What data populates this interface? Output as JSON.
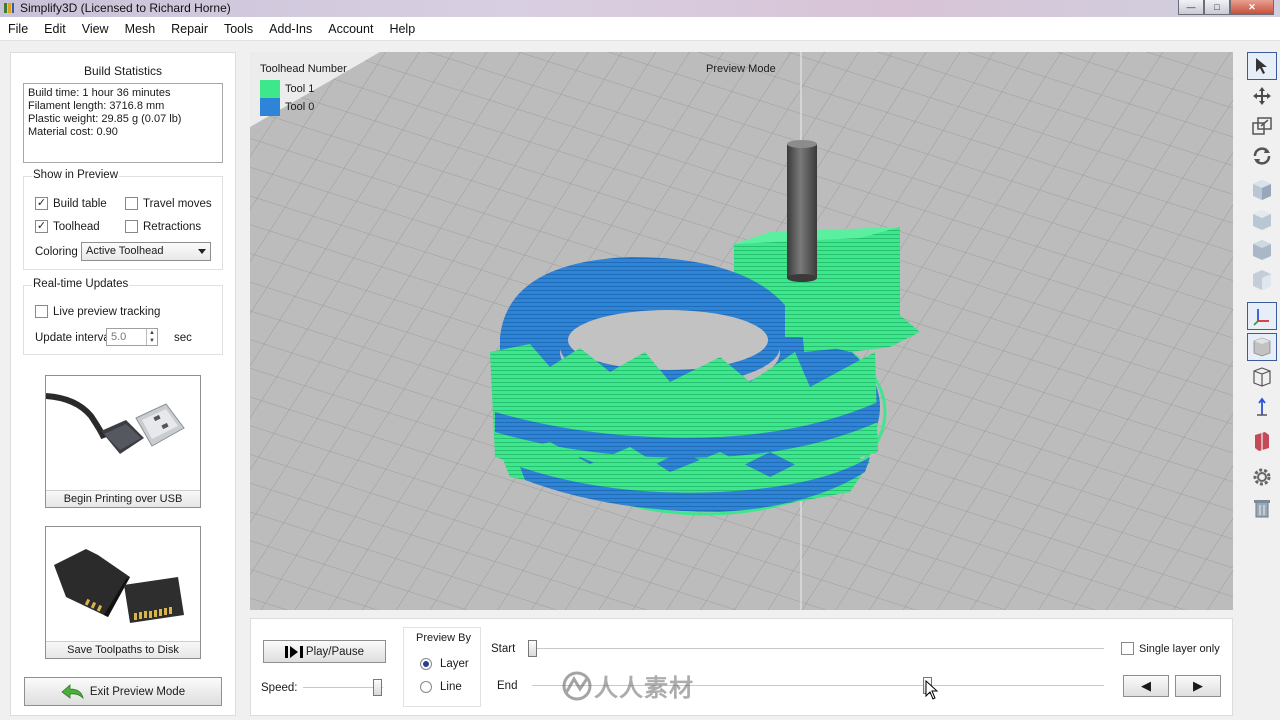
{
  "window": {
    "title": "Simplify3D (Licensed to Richard Horne)",
    "minimize_glyph": "—",
    "maximize_glyph": "□",
    "close_glyph": "✕"
  },
  "menu": [
    "File",
    "Edit",
    "View",
    "Mesh",
    "Repair",
    "Tools",
    "Add-Ins",
    "Account",
    "Help"
  ],
  "left_panel": {
    "build_statistics": {
      "title": "Build Statistics",
      "lines": [
        "Build time: 1 hour 36 minutes",
        "Filament length: 3716.8 mm",
        "Plastic weight: 29.85 g (0.07 lb)",
        "Material cost: 0.90"
      ]
    },
    "show_in_preview": {
      "title": "Show in Preview",
      "build_table": {
        "label": "Build table",
        "checked": true
      },
      "travel_moves": {
        "label": "Travel moves",
        "checked": false
      },
      "toolhead": {
        "label": "Toolhead",
        "checked": true
      },
      "retractions": {
        "label": "Retractions",
        "checked": false
      },
      "coloring_label": "Coloring",
      "coloring_value": "Active Toolhead"
    },
    "realtime_updates": {
      "title": "Real-time Updates",
      "live_preview": {
        "label": "Live preview tracking",
        "checked": false
      },
      "update_interval_label": "Update interval",
      "update_interval_value": "5.0",
      "unit": "sec"
    },
    "usb_button_label": "Begin Printing over USB",
    "sd_button_label": "Save Toolpaths to Disk",
    "exit_button_label": "Exit Preview Mode"
  },
  "viewport": {
    "legend_title": "Toolhead Number",
    "legend": [
      {
        "label": "Tool 1",
        "color": "#3ee68c"
      },
      {
        "label": "Tool 0",
        "color": "#2e84d6"
      }
    ],
    "mode_label": "Preview Mode"
  },
  "bottom_panel": {
    "play_pause_label": "Play/Pause",
    "speed_label": "Speed:",
    "speed_value": 0.93,
    "preview_by_title": "Preview By",
    "layer_label": "Layer",
    "line_label": "Line",
    "preview_by_selected": "Layer",
    "start_label": "Start",
    "end_label": "End",
    "start_value": 0.0,
    "end_value": 0.69,
    "single_layer_label": "Single layer only",
    "single_layer_checked": false,
    "prev_glyph": "◀",
    "next_glyph": "▶"
  },
  "right_toolbar": [
    {
      "icon": "select-arrow-icon",
      "active": true
    },
    {
      "icon": "move-icon",
      "active": false
    },
    {
      "icon": "scale-icon",
      "active": false
    },
    {
      "icon": "rotate-icon",
      "active": false
    },
    {
      "icon": "iso-view-icon",
      "active": false
    },
    {
      "icon": "front-view-icon",
      "active": false
    },
    {
      "icon": "top-view-icon",
      "active": false
    },
    {
      "icon": "side-view-icon",
      "active": false
    },
    {
      "icon": "axes-icon",
      "active": true
    },
    {
      "icon": "solid-view-icon",
      "active": true
    },
    {
      "icon": "wireframe-view-icon",
      "active": false
    },
    {
      "icon": "normals-icon",
      "active": false
    },
    {
      "icon": "cross-section-icon",
      "active": false
    },
    {
      "icon": "settings-gear-icon",
      "active": false
    },
    {
      "icon": "trash-icon",
      "active": false
    }
  ],
  "watermark": {
    "text": "人人素材"
  },
  "colors": {
    "tool1": "#3ee68c",
    "tool0": "#2e84d6",
    "bed": "#b7b7b7",
    "grid": "#9c9c9c"
  }
}
